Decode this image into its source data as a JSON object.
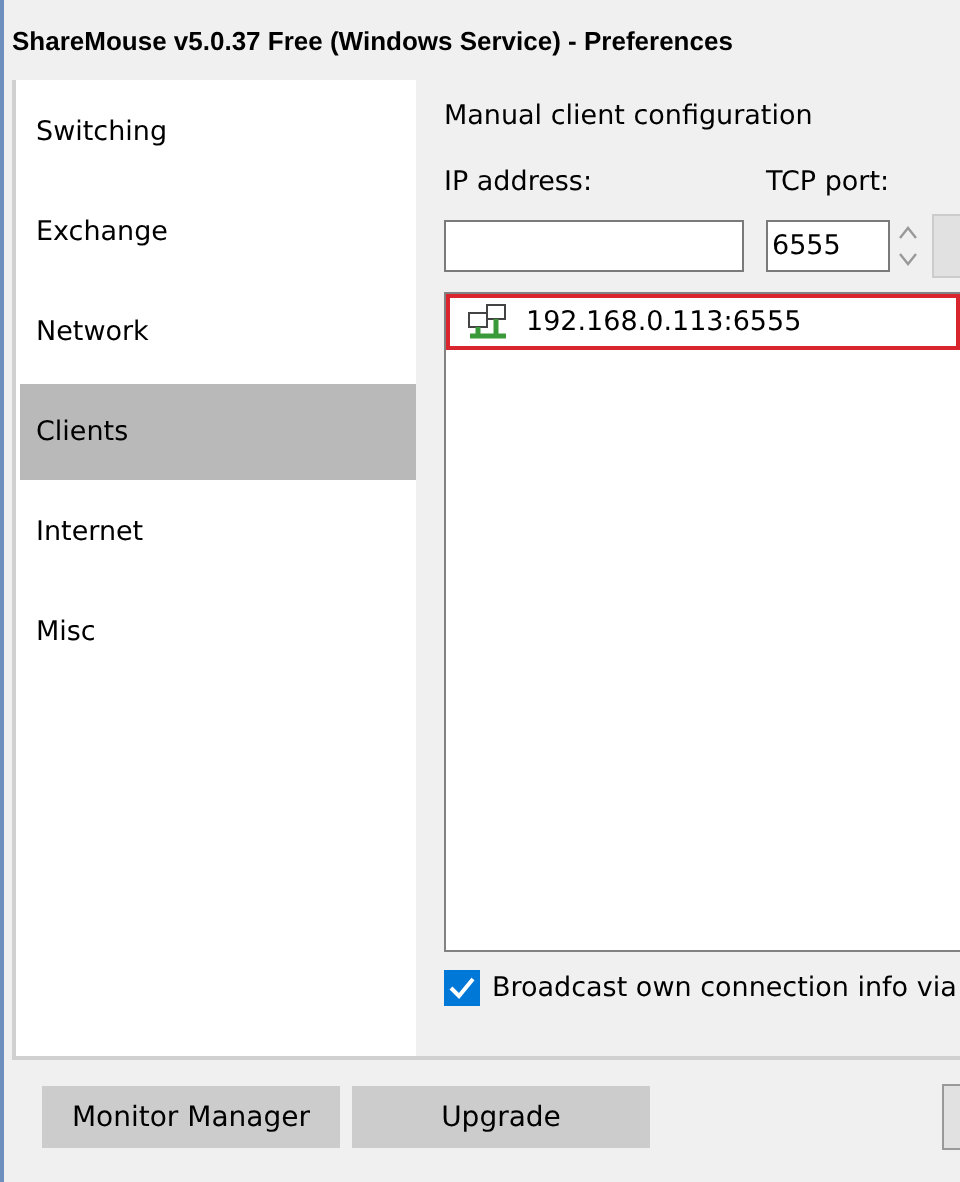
{
  "window": {
    "title": "ShareMouse v5.0.37 Free (Windows Service) - Preferences"
  },
  "sidebar": {
    "items": [
      {
        "label": "Switching",
        "selected": false
      },
      {
        "label": "Exchange",
        "selected": false
      },
      {
        "label": "Network",
        "selected": false
      },
      {
        "label": "Clients",
        "selected": true
      },
      {
        "label": "Internet",
        "selected": false
      },
      {
        "label": "Misc",
        "selected": false
      }
    ]
  },
  "content": {
    "heading": "Manual client configuration",
    "ip_label": "IP address:",
    "port_label": "TCP port:",
    "port_value": "6555",
    "clients": [
      {
        "address": "192.168.0.113:6555",
        "selected": true
      }
    ],
    "broadcast": {
      "label": "Broadcast own connection info via",
      "checked": true
    }
  },
  "buttons": [
    "Monitor Manager",
    "Upgrade"
  ]
}
